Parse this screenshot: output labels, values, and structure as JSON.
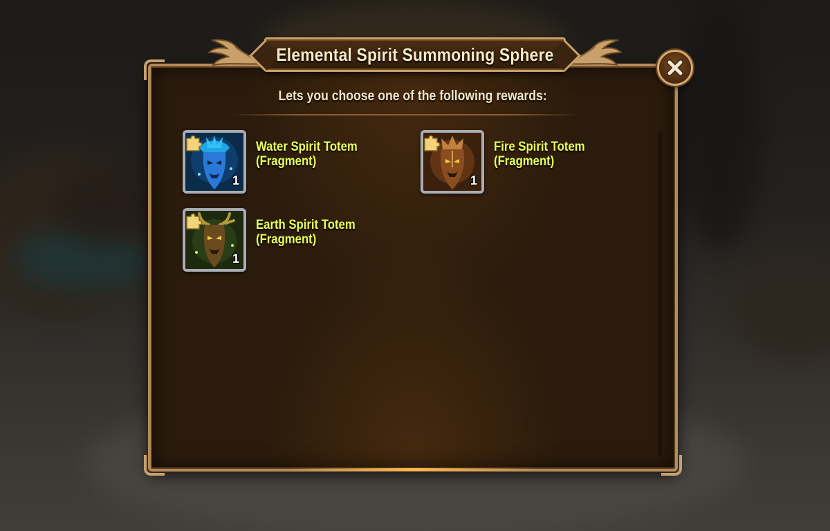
{
  "dialog": {
    "title": "Elemental Spirit Summoning Sphere",
    "subtitle": "Lets you choose one of the following rewards:",
    "close_icon": "close-x-icon"
  },
  "rewards": [
    {
      "line1": "Water Spirit Totem",
      "line2": "(Fragment)",
      "quantity": "1",
      "icon": "water-spirit-totem-icon",
      "color": "#2f7fe0"
    },
    {
      "line1": "Fire Spirit Totem",
      "line2": "(Fragment)",
      "quantity": "1",
      "icon": "fire-spirit-totem-icon",
      "color": "#a5621e"
    },
    {
      "line1": "Earth Spirit Totem",
      "line2": "(Fragment)",
      "quantity": "1",
      "icon": "earth-spirit-totem-icon",
      "color": "#5a7a1c"
    }
  ],
  "colors": {
    "panel_bg": "#2b1b0c",
    "frame_gold": "#c9a06a",
    "reward_name": "#e8ff5a",
    "title_text": "#fbe9c4"
  }
}
